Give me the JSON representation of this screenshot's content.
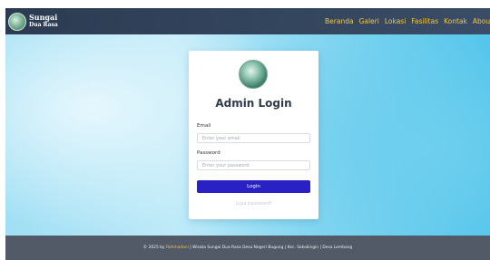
{
  "brand": {
    "line1": "Sungai",
    "line2": "Dua Rasa"
  },
  "nav": [
    "Beranda",
    "Galeri",
    "Lokasi",
    "Fasilitas",
    "Kontak",
    "About"
  ],
  "login": {
    "title": "Admin Login",
    "email_label": "Email",
    "email_placeholder": "Enter your email",
    "password_label": "Password",
    "password_placeholder": "Enter your password",
    "button": "Login",
    "forgot": "Lupa password?"
  },
  "footer": {
    "prefix": "© 2025 by",
    "highlight": "Rahmadani",
    "rest": "| Wisata Sungai Dua Rasa Desa Negeri Bugung | Kec. Sekokingin | Desa Lembang"
  },
  "colors": {
    "accent": "#2a21c4",
    "nav_link": "#f3c64a",
    "navbar": "#34465e",
    "footer": "#525a68"
  },
  "icons": [
    "logo-icon"
  ]
}
